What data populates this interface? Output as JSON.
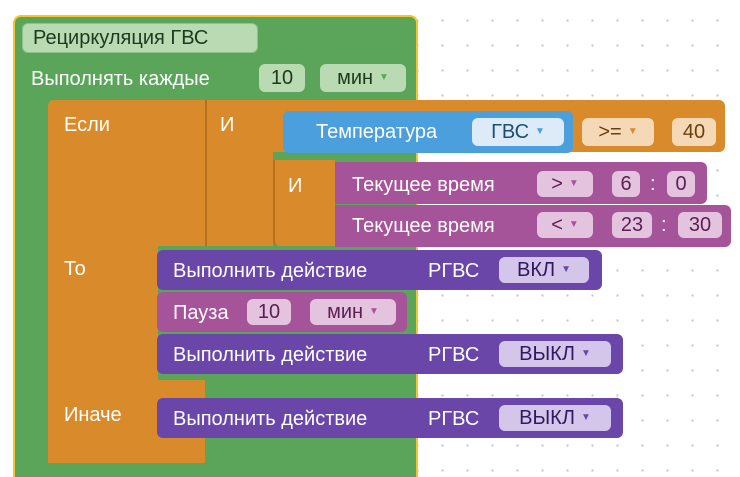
{
  "colors": {
    "loop_green": "#5ba55b",
    "loop_green_border": "#3f8a3f",
    "highlight_yellow": "#f7c52b",
    "if_orange": "#d98a2b",
    "if_orange_dark": "#b86f1c",
    "sensor_blue": "#4a9fdc",
    "time_magenta": "#a6549a",
    "action_purple": "#6a46a8",
    "pause_magenta": "#a6549a",
    "field_white": "#f4f4f4"
  },
  "loop": {
    "title": "Рециркуляция ГВС",
    "run_every_label": "Выполнять каждые",
    "interval_value": "10",
    "interval_unit": "мин"
  },
  "if_block": {
    "if_label": "Если",
    "then_label": "То",
    "else_label": "Иначе"
  },
  "condition": {
    "and_label_1": "И",
    "and_label_2": "И",
    "sensor": {
      "label": "Температура",
      "source": "ГВС",
      "operator": ">=",
      "value": "40"
    },
    "time_from": {
      "label": "Текущее время",
      "operator": ">",
      "hours": "6",
      "separator": ":",
      "minutes": "0"
    },
    "time_to": {
      "label": "Текущее время",
      "operator": "<",
      "hours": "23",
      "separator": ":",
      "minutes": "30"
    }
  },
  "then_actions": [
    {
      "label": "Выполнить действие",
      "device": "РГВС",
      "state": "ВКЛ"
    },
    {
      "pause_label": "Пауза",
      "pause_value": "10",
      "pause_unit": "мин"
    },
    {
      "label": "Выполнить действие",
      "device": "РГВС",
      "state": "ВЫКЛ"
    }
  ],
  "else_actions": [
    {
      "label": "Выполнить действие",
      "device": "РГВС",
      "state": "ВЫКЛ"
    }
  ]
}
